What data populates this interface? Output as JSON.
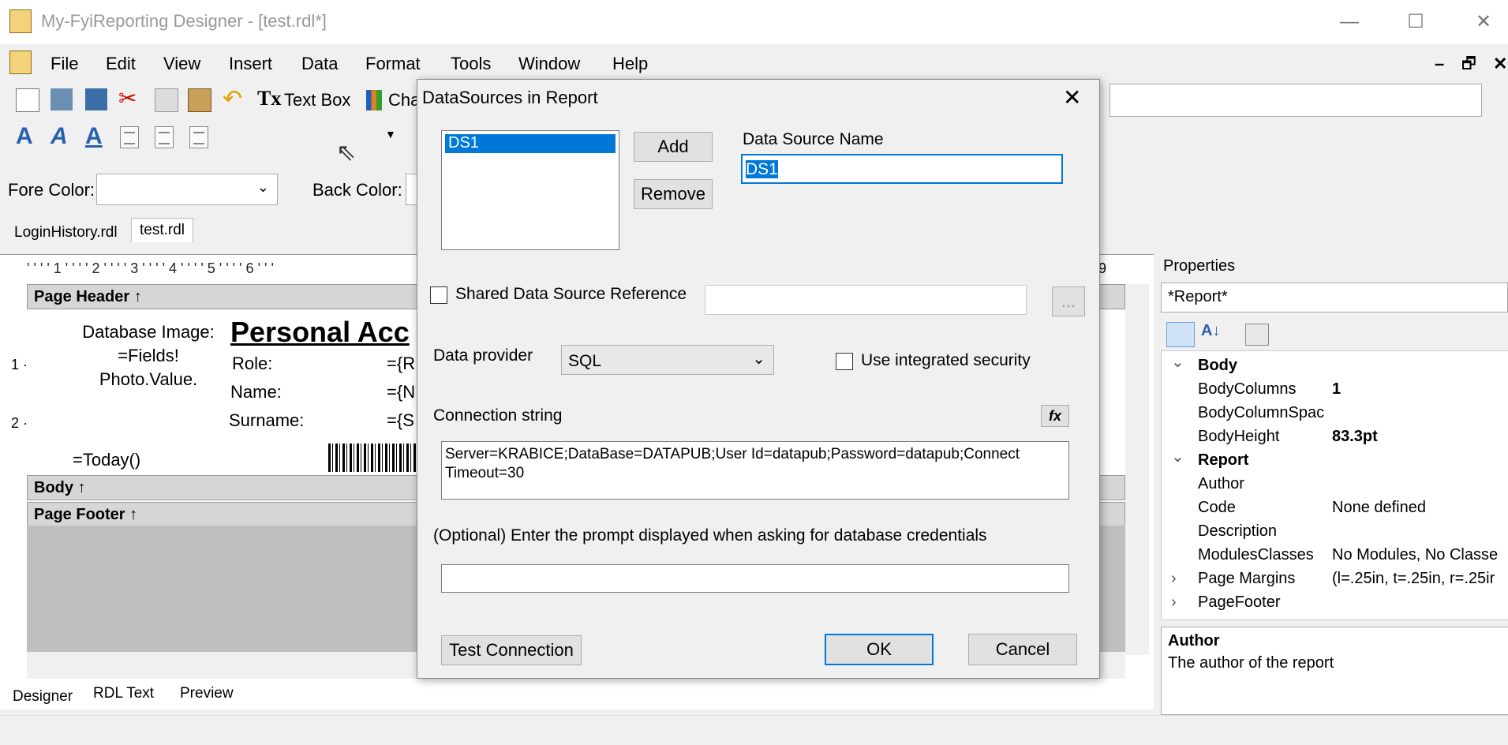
{
  "window": {
    "title": "My-FyiReporting Designer - [test.rdl*]",
    "minimize": "—",
    "maximize": "☐",
    "close": "✕"
  },
  "menu": [
    "File",
    "Edit",
    "View",
    "Insert",
    "Data",
    "Format",
    "Tools",
    "Window",
    "Help"
  ],
  "mdi_controls": {
    "min": "–",
    "restore": "🗗",
    "close": "✕"
  },
  "toolbar": {
    "textbox_label": "Text Box",
    "chart_label": "Cha",
    "fore_color_label": "Fore Color:",
    "back_color_label": "Back Color:"
  },
  "doc_tabs": [
    "LoginHistory.rdl",
    "test.rdl"
  ],
  "ruler": "' ' ' ' 1 ' ' ' ' 2 ' ' ' ' 3 ' ' ' ' 4 ' ' ' ' 5 ' ' ' ' 6 ' ' '",
  "ruler_right": "9",
  "report": {
    "page_header_band": "Page Header ↑",
    "body_band": "Body ↑",
    "page_footer_band": "Page Footer ↑",
    "image_text": "Database Image: =Fields! Photo.Value.",
    "title": "Personal Acc",
    "role_label": "Role:",
    "role_value": "={R",
    "name_label": "Name:",
    "name_value": "={N",
    "surname_label": "Surname:",
    "surname_value": "={S",
    "today": "=Today()",
    "vruler": [
      "1 ·",
      "2 ·"
    ]
  },
  "bottom_tabs": [
    "Designer",
    "RDL Text",
    "Preview"
  ],
  "properties": {
    "title": "Properties",
    "selector": "*Report*",
    "rows": [
      {
        "kind": "cat",
        "name": "Body",
        "expand": "⌄"
      },
      {
        "kind": "prop",
        "name": "BodyColumns",
        "value": "1",
        "bold": true
      },
      {
        "kind": "prop",
        "name": "BodyColumnSpac",
        "value": "",
        "bold": false
      },
      {
        "kind": "prop",
        "name": "BodyHeight",
        "value": "83.3pt",
        "bold": true
      },
      {
        "kind": "cat",
        "name": "Report",
        "expand": "⌄"
      },
      {
        "kind": "prop",
        "name": "Author",
        "value": "",
        "bold": false
      },
      {
        "kind": "prop",
        "name": "Code",
        "value": "None defined",
        "bold": false
      },
      {
        "kind": "prop",
        "name": "Description",
        "value": "",
        "bold": false
      },
      {
        "kind": "prop",
        "name": "ModulesClasses",
        "value": "No Modules, No Classe",
        "bold": false
      },
      {
        "kind": "sub",
        "name": "Page Margins",
        "value": "(l=.25in, t=.25in, r=.25ir",
        "bold": false
      },
      {
        "kind": "sub",
        "name": "PageFooter",
        "value": "",
        "bold": false
      }
    ],
    "desc_title": "Author",
    "desc_text": "The author of the report"
  },
  "dialog": {
    "title": "DataSources in Report",
    "list_items": [
      "DS1"
    ],
    "add": "Add",
    "remove": "Remove",
    "name_label": "Data Source Name",
    "name_value": "DS1",
    "shared_label": "Shared Data Source Reference",
    "browse": "...",
    "provider_label": "Data provider",
    "provider_value": "SQL",
    "integrated_label": "Use integrated security",
    "conn_label": "Connection string",
    "fx": "fx",
    "conn_value": "Server=KRABICE;DataBase=DATAPUB;User Id=datapub;Password=datapub;Connect Timeout=30",
    "prompt_label": "(Optional) Enter the prompt displayed when asking for database credentials",
    "prompt_value": "",
    "test": "Test Connection",
    "ok": "OK",
    "cancel": "Cancel"
  },
  "colors": {
    "selection": "#0078d7",
    "band": "#d6d6d6",
    "footer": "#bfbfbf"
  }
}
